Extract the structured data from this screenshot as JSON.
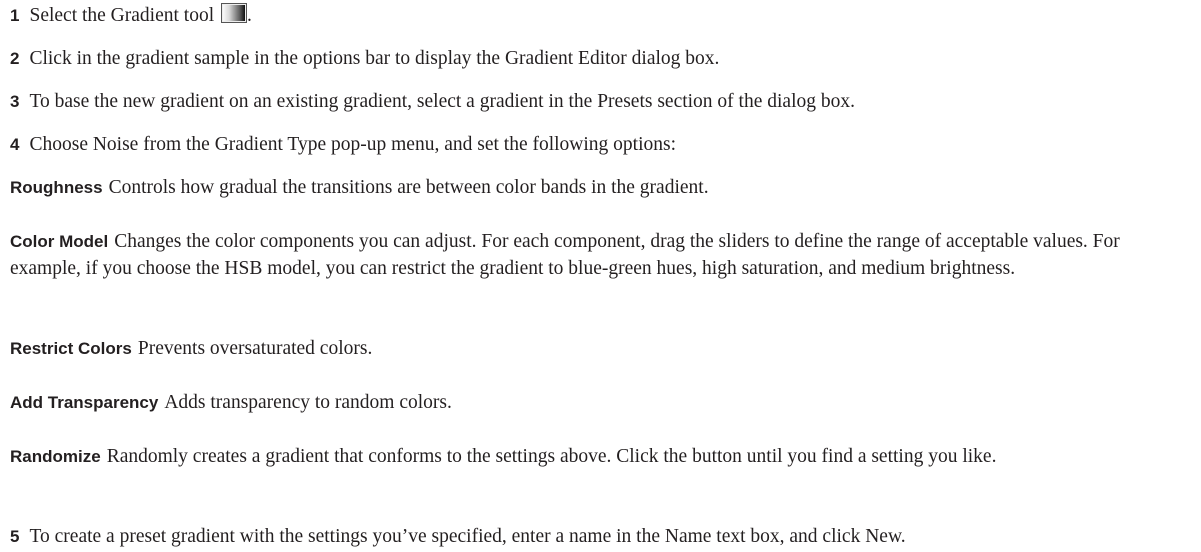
{
  "steps": {
    "s1": {
      "num": "1",
      "before": "Select the Gradient tool",
      "icon": "gradient-tool-icon",
      "after": "."
    },
    "s2": {
      "num": "2",
      "text": "Click in the gradient sample in the options bar to display the Gradient Editor dialog box."
    },
    "s3": {
      "num": "3",
      "text": "To base the new gradient on an existing gradient, select a gradient in the Presets section of the dialog box."
    },
    "s4": {
      "num": "4",
      "text": "Choose Noise from the Gradient Type pop-up menu, and set the following options:"
    },
    "s5": {
      "num": "5",
      "text": "To create a preset gradient with the settings you’ve specified, enter a name in the Name text box, and click New."
    }
  },
  "options": {
    "roughness": {
      "term": "Roughness",
      "text": "Controls how gradual the transitions are between color bands in the gradient."
    },
    "color_model": {
      "term": "Color Model",
      "text": "Changes the color components you can adjust. For each component, drag the sliders to define the range of acceptable values. For example, if you choose the HSB model, you can restrict the gradient to blue-green hues, high saturation, and medium brightness."
    },
    "restrict_colors": {
      "term": "Restrict Colors",
      "text": "Prevents oversaturated colors."
    },
    "add_transparency": {
      "term": "Add Transparency",
      "text": "Adds transparency to random colors."
    },
    "randomize": {
      "term": "Randomize",
      "text": "Randomly creates a gradient that conforms to the settings above. Click the button until you find a setting you like."
    }
  },
  "colors": {
    "text": "#231f20",
    "background": "#ffffff"
  }
}
